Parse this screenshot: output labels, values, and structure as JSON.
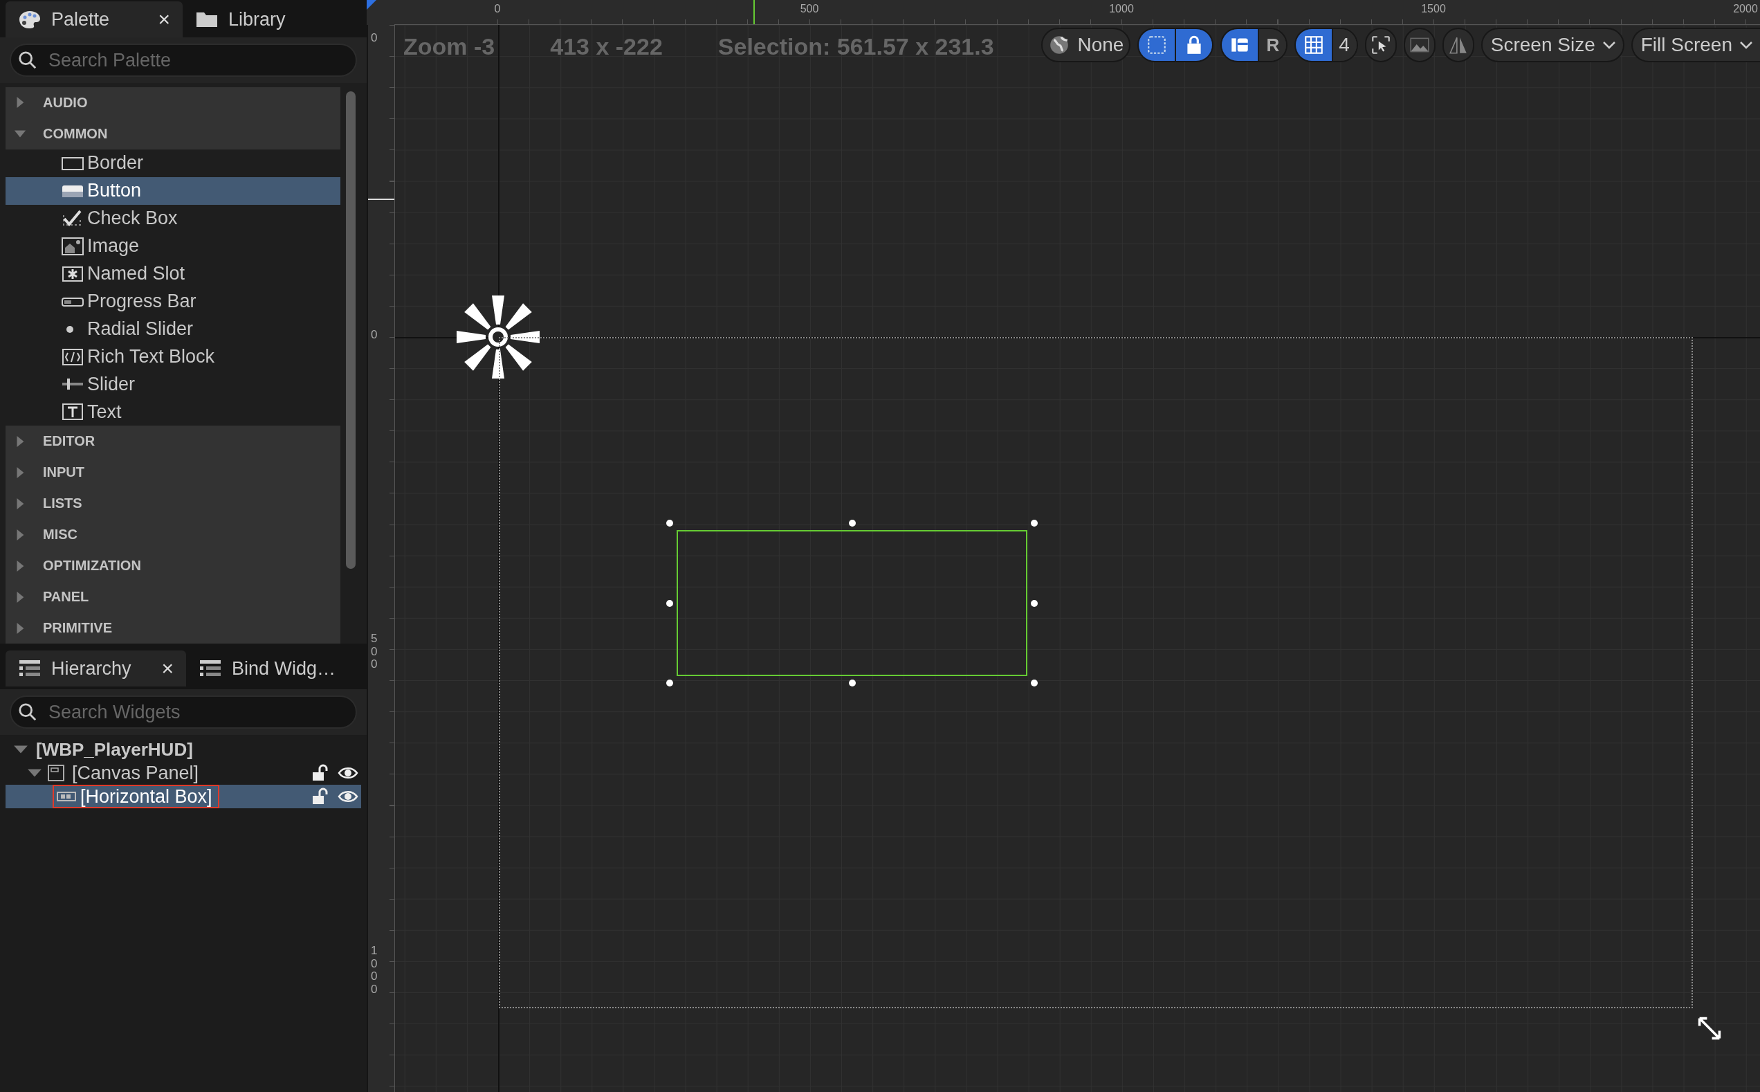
{
  "palette_panel": {
    "tabs": [
      {
        "label": "Palette",
        "selected": true,
        "close": "×"
      },
      {
        "label": "Library",
        "selected": false
      }
    ],
    "search": {
      "placeholder": "Search Palette"
    },
    "categories": [
      {
        "label": "AUDIO",
        "expanded": false
      },
      {
        "label": "COMMON",
        "expanded": true,
        "items": [
          {
            "label": "Border",
            "kind": "border",
            "selected": false
          },
          {
            "label": "Button",
            "kind": "button",
            "selected": true
          },
          {
            "label": "Check Box",
            "kind": "checkbox",
            "selected": false
          },
          {
            "label": "Image",
            "kind": "image",
            "selected": false
          },
          {
            "label": "Named Slot",
            "kind": "namedslot",
            "selected": false
          },
          {
            "label": "Progress Bar",
            "kind": "progress",
            "selected": false
          },
          {
            "label": "Radial Slider",
            "kind": "radial",
            "selected": false
          },
          {
            "label": "Rich Text Block",
            "kind": "richtext",
            "selected": false
          },
          {
            "label": "Slider",
            "kind": "slider",
            "selected": false
          },
          {
            "label": "Text",
            "kind": "text",
            "selected": false
          }
        ]
      },
      {
        "label": "EDITOR",
        "expanded": false
      },
      {
        "label": "INPUT",
        "expanded": false
      },
      {
        "label": "LISTS",
        "expanded": false
      },
      {
        "label": "MISC",
        "expanded": false
      },
      {
        "label": "OPTIMIZATION",
        "expanded": false
      },
      {
        "label": "PANEL",
        "expanded": false
      },
      {
        "label": "PRIMITIVE",
        "expanded": false
      }
    ]
  },
  "hierarchy_panel": {
    "tabs": [
      {
        "label": "Hierarchy",
        "selected": true,
        "close": "×"
      },
      {
        "label": "Bind Widg…",
        "selected": false
      }
    ],
    "search": {
      "placeholder": "Search Widgets"
    },
    "tree": [
      {
        "label": "[WBP_PlayerHUD]",
        "kind": "root",
        "selected": false,
        "expanded": true,
        "children": [
          {
            "label": "[Canvas Panel]",
            "kind": "canvas",
            "selected": false,
            "expanded": true,
            "locked": false,
            "visible": true,
            "children": [
              {
                "label": "[Horizontal Box]",
                "kind": "hbox",
                "selected": true,
                "locked": false,
                "visible": true
              }
            ]
          }
        ]
      }
    ]
  },
  "designer": {
    "top_ruler": {
      "labels": [
        "0",
        "500",
        "1000",
        "1500",
        "2000"
      ]
    },
    "left_ruler": {
      "labels": [
        "0",
        "0",
        "500",
        "1000"
      ]
    },
    "zoom_label": "Zoom -3",
    "cursor_position": "413 x -222",
    "selection_size": "Selection: 561.57 x 231.3",
    "toolbar": {
      "culture": "None",
      "outline_toggle": {
        "on": true
      },
      "lock_toggle": {
        "on": true
      },
      "widget_toggle": {
        "on": true
      },
      "render_toggle": {
        "label": "R",
        "on": false
      },
      "grid_toggle": {
        "on": true
      },
      "grid_size": "4",
      "cursor_toggle": {
        "on": false
      },
      "background_toggle": {
        "on": false
      },
      "flip_toggle": {
        "on": false
      },
      "screen_size": "Screen Size",
      "fill_mode": "Fill Screen"
    }
  }
}
